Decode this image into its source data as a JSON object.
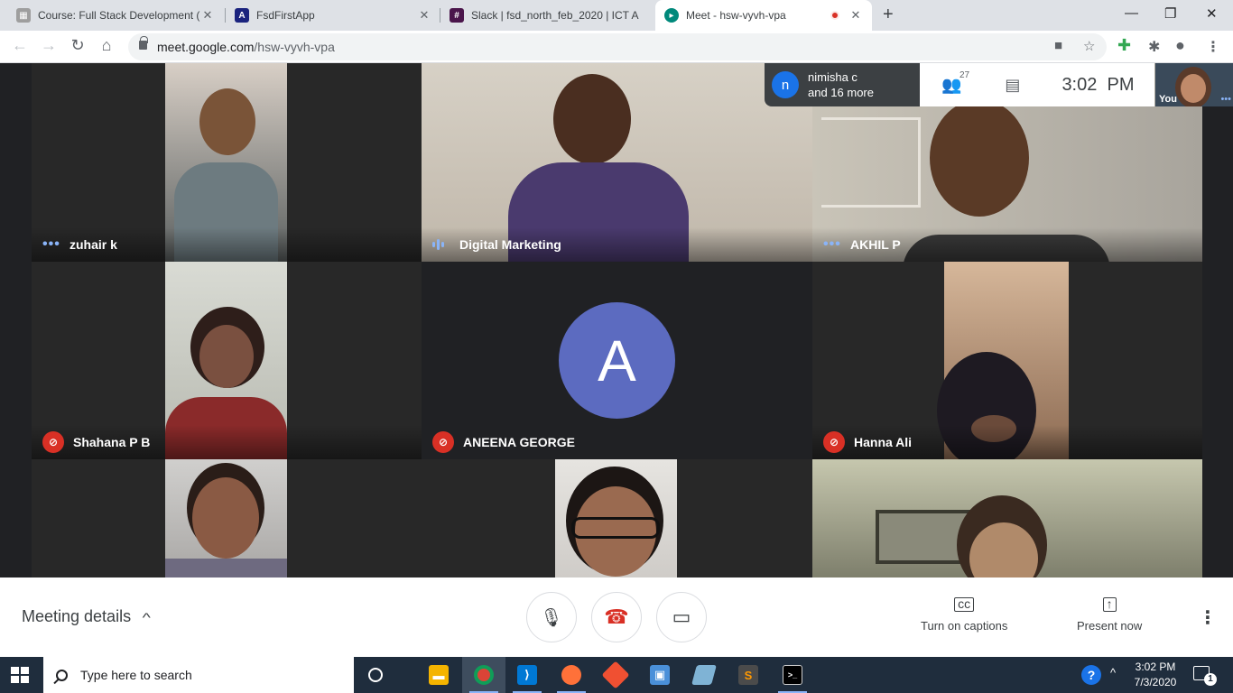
{
  "browser": {
    "tabs": [
      {
        "label": "Course: Full Stack Development (",
        "icon": "course-page-icon",
        "color": "#9e9e9e"
      },
      {
        "label": "FsdFirstApp",
        "icon": "angular-icon",
        "color": "#1a237e"
      },
      {
        "label": "Slack | fsd_north_feb_2020 | ICT A",
        "icon": "slack-icon",
        "color": "#4a154b"
      },
      {
        "label": "Meet - hsw-vyvh-vpa",
        "icon": "meet-icon",
        "color": "#00897b",
        "active": true
      }
    ],
    "url_host": "meet.google.com",
    "url_path": "/hsw-vyvh-vpa"
  },
  "meet": {
    "tiles": [
      {
        "name": "zuhair k",
        "indicator": "dots"
      },
      {
        "name": "Digital Marketing",
        "indicator": "speaking"
      },
      {
        "name": "AKHIL P",
        "indicator": "dots"
      },
      {
        "name": "Shahana P B",
        "indicator": "muted"
      },
      {
        "name": "ANEENA GEORGE",
        "indicator": "muted",
        "avatar_letter": "A"
      },
      {
        "name": "Hanna Ali",
        "indicator": "muted"
      },
      {
        "name": "",
        "indicator": "none"
      },
      {
        "name": "",
        "indicator": "none"
      },
      {
        "name": "",
        "indicator": "none"
      }
    ],
    "participants_pill": {
      "avatar_letter": "n",
      "line1": "nimisha c",
      "line2": "and 16 more"
    },
    "participant_count": "27",
    "time": "3:02  PM",
    "self_label": "You",
    "controls": {
      "meeting_details": "Meeting details",
      "captions": "Turn on captions",
      "present": "Present now"
    },
    "colors": {
      "muted_red": "#d93025",
      "avatar_blue": "#5c6bc0",
      "accent": "#8ab4f8"
    }
  },
  "taskbar": {
    "search_placeholder": "Type here to search",
    "time": "3:02 PM",
    "date": "7/3/2020",
    "notification_count": "1"
  }
}
